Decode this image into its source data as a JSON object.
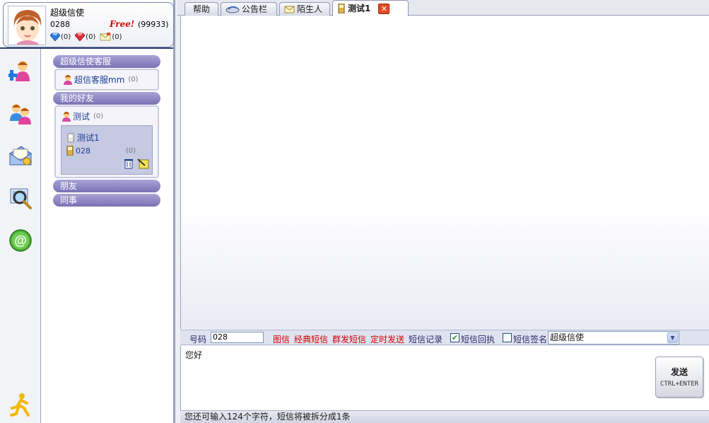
{
  "profile": {
    "nickname": "超级信使",
    "phone": "0288",
    "free_badge": "Free!",
    "score": "(99933)",
    "stats": [
      {
        "icon": "blue-diamond-icon",
        "count": "(0)"
      },
      {
        "icon": "red-gem-icon",
        "count": "(0)"
      },
      {
        "icon": "envelope-icon",
        "count": "(0)"
      }
    ]
  },
  "sidebar_icons": [
    "add-contact-icon",
    "contacts-icon",
    "messages-icon",
    "search-icon",
    "email-at-icon",
    "aim-runner-icon"
  ],
  "groups": {
    "service": {
      "title": "超级信使客服",
      "member": {
        "name": "超信客服mm",
        "count": "(0)"
      }
    },
    "friends": {
      "title": "我的好友",
      "member": {
        "name": "测试",
        "count": "(0)"
      },
      "detail": {
        "name": "测试1",
        "phone": "028",
        "count": "(0)"
      }
    },
    "pals": {
      "title": "朋友"
    },
    "colleagues": {
      "title": "同事"
    }
  },
  "tabs": [
    {
      "label": "帮助",
      "icon": ""
    },
    {
      "label": "公告栏",
      "icon": "bulletin-icon"
    },
    {
      "label": "陌生人",
      "icon": "envelope-icon"
    },
    {
      "label": "测试1",
      "icon": "phone-icon",
      "active": true
    }
  ],
  "toolbar": {
    "number_label": "号码",
    "number_value": "028",
    "links": [
      "图信",
      "经典短信",
      "群发短信",
      "定时发送"
    ],
    "history": "短信记录",
    "receipt_label": "短信回执",
    "receipt_checked": true,
    "signature_label": "短信签名",
    "signature_checked": false,
    "signature_value": "超级信使"
  },
  "compose": {
    "text": "您好",
    "send_label": "发送",
    "send_hint": "CTRL+ENTER"
  },
  "status": "您还可输入124个字符，短信将被拆分成1条"
}
